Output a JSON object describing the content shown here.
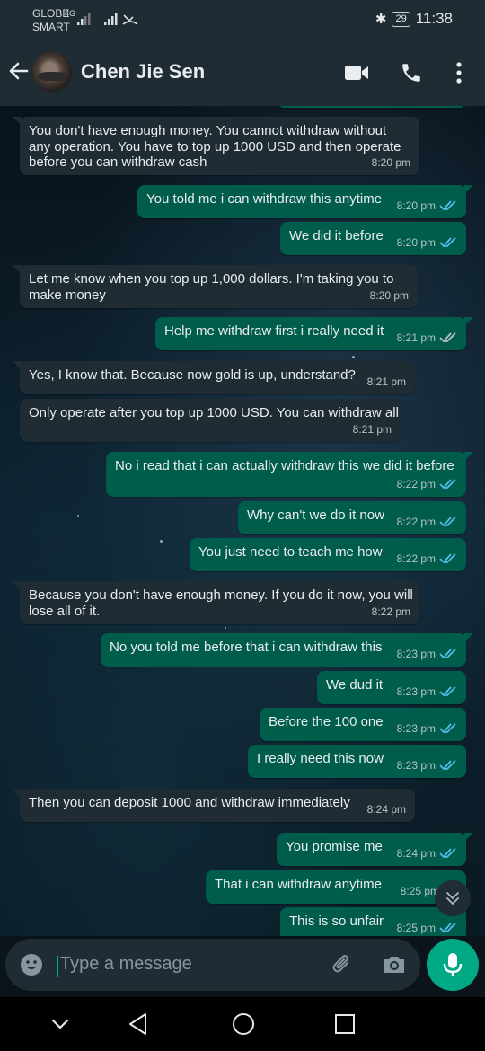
{
  "status_bar": {
    "carrier_line1": "GLOBE",
    "carrier_line2": "SMART",
    "network": "4G",
    "battery": "29",
    "time": "11:38"
  },
  "header": {
    "contact_name": "Chen Jie Sen",
    "icons": [
      "back-arrow-icon",
      "video-call-icon",
      "phone-icon",
      "more-options-icon"
    ]
  },
  "messages": [
    {
      "dir": "in",
      "lines": [
        "You don't have enough money. You cannot withdraw without",
        "any operation. You have to top up 1000 USD and then operate",
        "before you can withdraw cash"
      ],
      "time": "8:20 pm"
    },
    {
      "dir": "out",
      "lines": [
        "You told me i can withdraw this anytime"
      ],
      "time": "8:20 pm"
    },
    {
      "dir": "out",
      "lines": [
        "We did it before"
      ],
      "time": "8:20 pm"
    },
    {
      "dir": "in",
      "lines": [
        "Let me know when you top up 1,000 dollars. I'm taking you to",
        "make money"
      ],
      "time": "8:20 pm"
    },
    {
      "dir": "out",
      "lines": [
        "Help me withdraw first i really need it"
      ],
      "time": "8:21 pm"
    },
    {
      "dir": "in",
      "lines": [
        "Yes, I know that. Because now gold is up, understand?"
      ],
      "time": "8:21 pm"
    },
    {
      "dir": "in",
      "lines": [
        "Only operate after you top up 1000 USD. You can withdraw all"
      ],
      "time": "8:21 pm"
    },
    {
      "dir": "out",
      "lines": [
        "No i read that i can actually withdraw this we did it before"
      ],
      "time": "8:22 pm"
    },
    {
      "dir": "out",
      "lines": [
        "Why can't we do it now"
      ],
      "time": "8:22 pm"
    },
    {
      "dir": "out",
      "lines": [
        "You just need to teach me how"
      ],
      "time": "8:22 pm"
    },
    {
      "dir": "in",
      "lines": [
        "Because you don't have enough money. If you do it now, you will",
        "lose all of it."
      ],
      "time": "8:22 pm"
    },
    {
      "dir": "out",
      "lines": [
        "No you told me before that i can withdraw this"
      ],
      "time": "8:23 pm"
    },
    {
      "dir": "out",
      "lines": [
        "We dud it"
      ],
      "time": "8:23 pm"
    },
    {
      "dir": "out",
      "lines": [
        "Before the 100 one"
      ],
      "time": "8:23 pm"
    },
    {
      "dir": "out",
      "lines": [
        "I really need this now"
      ],
      "time": "8:23 pm"
    },
    {
      "dir": "in",
      "lines": [
        "Then you can deposit 1000 and withdraw immediately"
      ],
      "time": "8:24 pm"
    },
    {
      "dir": "out",
      "lines": [
        "You promise me"
      ],
      "time": "8:24 pm"
    },
    {
      "dir": "out",
      "lines": [
        "That i can withdraw anytime"
      ],
      "time": "8:25 pm"
    },
    {
      "dir": "out",
      "lines": [
        "This is so unfair"
      ],
      "time": "8:25 pm"
    }
  ],
  "composer": {
    "placeholder": "Type a message"
  },
  "colors": {
    "incoming_bubble": "#1f2c34",
    "outgoing_bubble": "#005c4b",
    "read_tick": "#53bdeb",
    "accent": "#00a884"
  }
}
